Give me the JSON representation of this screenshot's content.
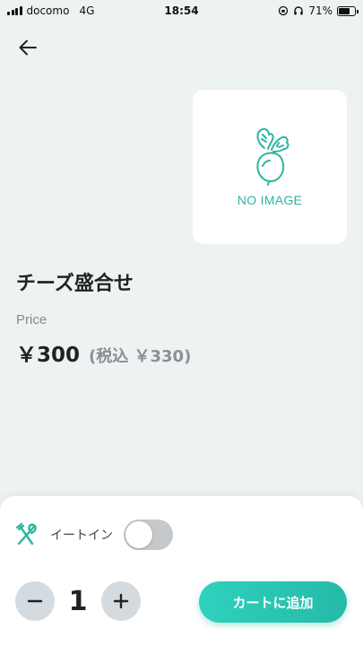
{
  "status_bar": {
    "carrier": "docomo",
    "network": "4G",
    "time": "18:54",
    "battery": "71%",
    "battery_level": 0.71
  },
  "product": {
    "image_placeholder": "NO IMAGE",
    "name": "チーズ盛合せ",
    "price_caption": "Price",
    "price": "￥300",
    "price_with_tax": "(税込 ￥330)"
  },
  "order": {
    "eat_in_label": "イートイン",
    "eat_in_enabled": false,
    "quantity": "1",
    "add_to_cart_label": "カートに追加"
  },
  "colors": {
    "accent": "#2bb5a0",
    "background": "#edf2f2"
  }
}
